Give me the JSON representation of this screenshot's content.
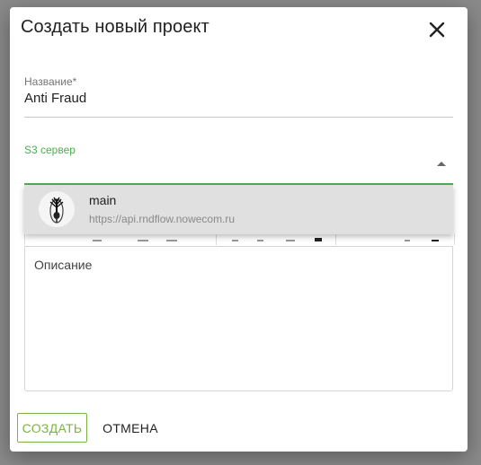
{
  "dialog": {
    "title": "Создать новый проект",
    "close_icon": "close-icon"
  },
  "form": {
    "name_label": "Название*",
    "name_value": "Anti Fraud",
    "s3_label": "S3 сервер",
    "s3_value": "",
    "description_placeholder": "Описание"
  },
  "dropdown": {
    "options": [
      {
        "name": "main",
        "url": "https://api.rndflow.nowecom.ru",
        "icon": "server-logo-icon"
      }
    ]
  },
  "actions": {
    "create_label": "СОЗДАТЬ",
    "cancel_label": "ОТМЕНА"
  },
  "colors": {
    "accent_green": "#4caf50",
    "create_button_green": "#7cb342",
    "dropdown_bg": "#e0e0e0"
  }
}
